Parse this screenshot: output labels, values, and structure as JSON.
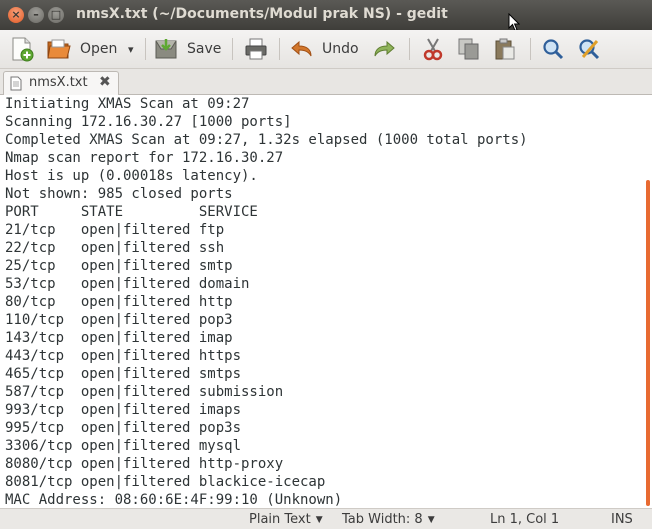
{
  "window": {
    "title": "nmsX.txt (~/Documents/Modul prak NS) - gedit",
    "close_glyph": "×",
    "minimize_glyph": "–",
    "maximize_glyph": "□"
  },
  "toolbar": {
    "new_icon": "new-document-icon",
    "open_label": "Open",
    "open_dropdown_glyph": "▾",
    "save_label": "Save",
    "print_icon": "print-icon",
    "undo_label": "Undo",
    "redo_icon": "redo-icon",
    "cut_icon": "cut-icon",
    "copy_icon": "copy-icon",
    "paste_icon": "paste-icon",
    "find_icon": "search-icon",
    "replace_icon": "find-replace-icon"
  },
  "tabs": [
    {
      "label": "nmsX.txt",
      "close_glyph": "✖"
    }
  ],
  "document": {
    "lines": [
      "Initiating XMAS Scan at 09:27",
      "Scanning 172.16.30.27 [1000 ports]",
      "Completed XMAS Scan at 09:27, 1.32s elapsed (1000 total ports)",
      "Nmap scan report for 172.16.30.27",
      "Host is up (0.00018s latency).",
      "Not shown: 985 closed ports",
      "PORT     STATE         SERVICE",
      "21/tcp   open|filtered ftp",
      "22/tcp   open|filtered ssh",
      "25/tcp   open|filtered smtp",
      "53/tcp   open|filtered domain",
      "80/tcp   open|filtered http",
      "110/tcp  open|filtered pop3",
      "143/tcp  open|filtered imap",
      "443/tcp  open|filtered https",
      "465/tcp  open|filtered smtps",
      "587/tcp  open|filtered submission",
      "993/tcp  open|filtered imaps",
      "995/tcp  open|filtered pop3s",
      "3306/tcp open|filtered mysql",
      "8080/tcp open|filtered http-proxy",
      "8081/tcp open|filtered blackice-icecap",
      "MAC Address: 08:60:6E:4F:99:10 (Unknown)"
    ]
  },
  "statusbar": {
    "language": "Plain Text",
    "tab_width": "Tab Width: 8",
    "dropdown_glyph": "▼",
    "position": "Ln 1, Col 1",
    "mode": "INS"
  },
  "colors": {
    "scrollbar": "#e86a31",
    "close_button": "#e15a25"
  }
}
